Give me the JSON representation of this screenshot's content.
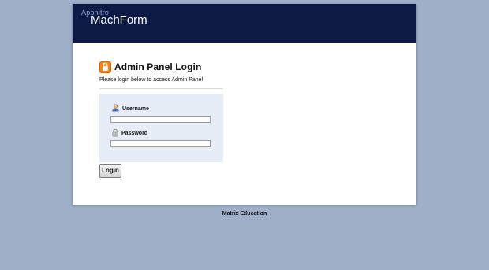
{
  "header": {
    "brand_small": "Appnitro",
    "brand_name": "MachForm",
    "brand_logo_icon": "crescent-logo-icon"
  },
  "login": {
    "title": "Admin Panel Login",
    "subtitle": "Please login below to access Admin Panel",
    "lock_icon": "lock-icon",
    "username_label": "Username",
    "password_label": "Password",
    "username_value": "",
    "password_value": "",
    "button_label": "Login"
  },
  "footer": {
    "text": "Matrix Education"
  },
  "colors": {
    "page_background": "#9fb0c8",
    "header_background": "#0d1a45",
    "panel_background": "#e6edf7",
    "accent_orange": "#ff7f11"
  }
}
